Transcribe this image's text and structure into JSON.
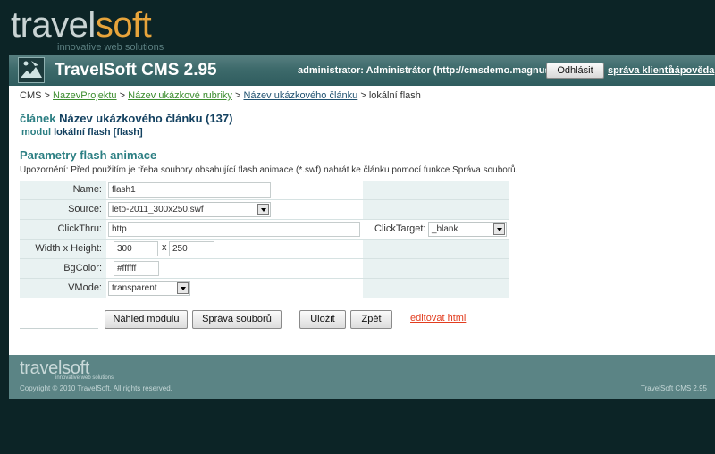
{
  "brand": {
    "name_part1": "travel",
    "name_part2": "soft",
    "tagline": "innovative web solutions"
  },
  "header": {
    "app_title": "TravelSoft CMS 2.95",
    "user_info": "administrator: Administrátor (http://cmsdemo.magnus3.cz)",
    "logout_label": "Odhlásit",
    "links": [
      "správa klientů",
      "nápověda"
    ]
  },
  "breadcrumb": {
    "root": "CMS",
    "separator": ">",
    "items": [
      "NazevProjektu",
      "Název ukázkové rubriky",
      "Název ukázkového článku"
    ],
    "current": "lokální flash"
  },
  "article": {
    "label": "článek",
    "title": "Název ukázkového článku (137)"
  },
  "module": {
    "label": "modul",
    "title": "lokální flash [flash]"
  },
  "section": {
    "title": "Parametry flash animace",
    "warning": "Upozornění: Před použitím je třeba soubory obsahující flash animace (*.swf) nahrát ke článku pomocí funkce Správa souborů."
  },
  "form": {
    "name": {
      "label": "Name:",
      "value": "flash1"
    },
    "source": {
      "label": "Source:",
      "value": "leto-2011_300x250.swf"
    },
    "clickthru": {
      "label": "ClickThru:",
      "value": "http"
    },
    "clicktarget": {
      "label": "ClickTarget:",
      "value": "_blank"
    },
    "size": {
      "label": "Width x Height:",
      "width": "300",
      "separator": "x",
      "height": "250"
    },
    "bgcolor": {
      "label": "BgColor:",
      "value": "#ffffff"
    },
    "vmode": {
      "label": "VMode:",
      "value": "transparent"
    }
  },
  "buttons": {
    "preview": "Náhled modulu",
    "files": "Správa souborů",
    "save": "Uložit",
    "back": "Zpět",
    "edit_html": "editovat html"
  },
  "footer": {
    "logo": "travelsoft",
    "tagline": "innovative web solutions",
    "copyright": "Copyright © 2010 TravelSoft. All rights reserved.",
    "version": "TravelSoft CMS 2.95"
  },
  "colors": {
    "page_bg": "#0c2426",
    "header_bar": "#3d6a6b",
    "accent_teal": "#2c7f83",
    "accent_orange": "#e7a43b",
    "link_green": "#3b8c2e",
    "link_red": "#e23c1e",
    "footer_bg": "#5b8485"
  }
}
